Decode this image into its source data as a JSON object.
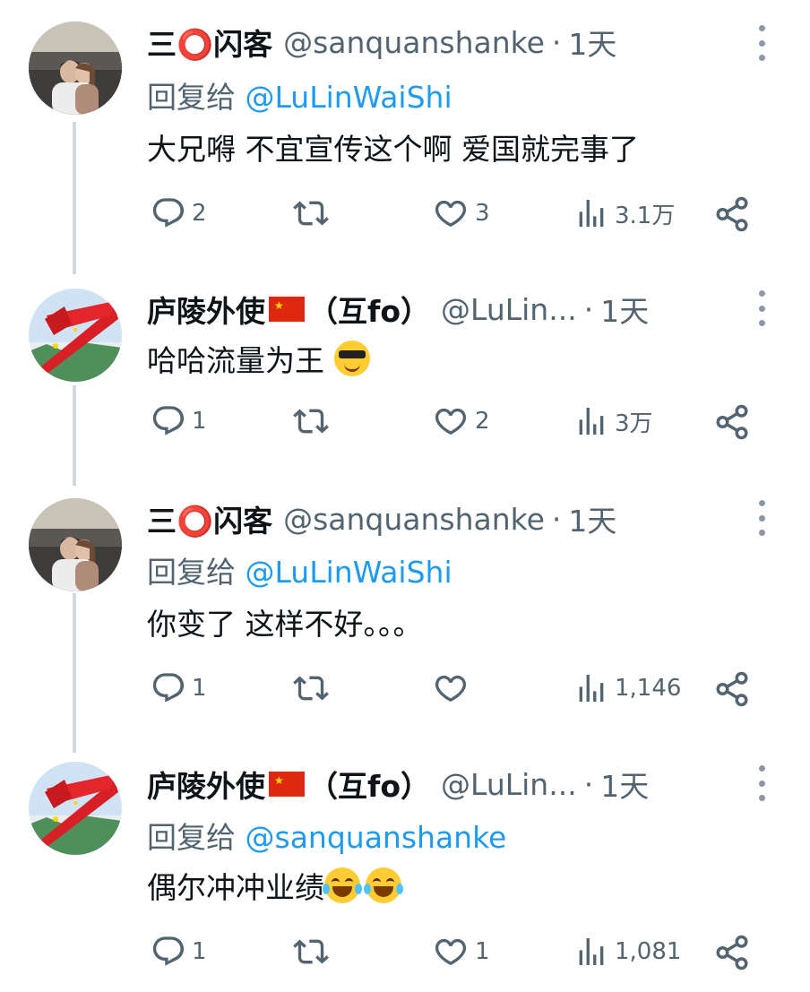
{
  "tweets": [
    {
      "display_name": "三⭕闪客",
      "handle": "@sanquanshanke",
      "dot": "·",
      "time": "1天",
      "reply_prefix": "回复给",
      "reply_mention": "@LuLinWaiShi",
      "text": "大兄嘚 不宜宣传这个啊 爱国就完事了",
      "stats": {
        "replies": "2",
        "retweets": "",
        "likes": "3",
        "views": "3.1万"
      }
    },
    {
      "display_name": "庐陵外使",
      "display_name_suffix": "（互fo）",
      "handle": "@LuLin...",
      "dot": "·",
      "time": "1天",
      "text": "哈哈流量为王",
      "stats": {
        "replies": "1",
        "retweets": "",
        "likes": "2",
        "views": "3万"
      }
    },
    {
      "display_name": "三⭕闪客",
      "handle": "@sanquanshanke",
      "dot": "·",
      "time": "1天",
      "reply_prefix": "回复给",
      "reply_mention": "@LuLinWaiShi",
      "text": "你变了 这样不好。。。",
      "stats": {
        "replies": "1",
        "retweets": "",
        "likes": "",
        "views": "1,146"
      }
    },
    {
      "display_name": "庐陵外使",
      "display_name_suffix": "（互fo）",
      "handle": "@LuLin...",
      "dot": "·",
      "time": "1天",
      "reply_prefix": "回复给",
      "reply_mention": "@sanquanshanke",
      "text": "偶尔冲冲业绩",
      "stats": {
        "replies": "1",
        "retweets": "",
        "likes": "1",
        "views": "1,081"
      }
    }
  ],
  "colors": {
    "accent": "#1d9bf0",
    "secondary_text": "#536471",
    "thread_line": "#cfd9de",
    "flag_red": "#de2910"
  },
  "icons": [
    "reply-icon",
    "retweet-icon",
    "like-icon",
    "views-icon",
    "share-icon",
    "more-icon",
    "china-flag-icon",
    "cool-emoji",
    "tears-of-joy-emoji"
  ]
}
